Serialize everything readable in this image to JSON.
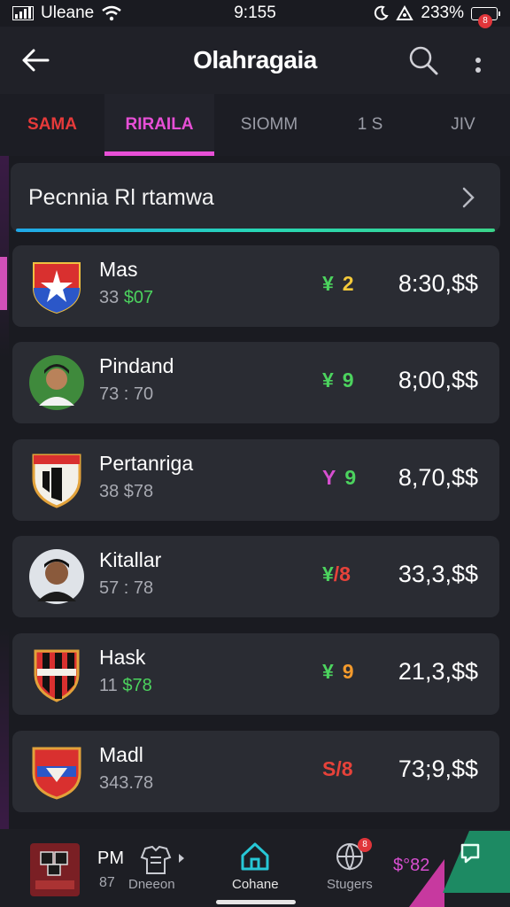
{
  "status_bar": {
    "carrier": "Uleane",
    "time": "9:155",
    "battery": "233%"
  },
  "app_bar": {
    "title": "Olahragaia",
    "badge": "8"
  },
  "tabs": [
    {
      "label": "SAMA"
    },
    {
      "label": "RIRAILA"
    },
    {
      "label": "SIOMM"
    },
    {
      "label": "1 S"
    },
    {
      "label": "JIV"
    }
  ],
  "featured": {
    "label": "Pecnnia Rl rtamwa"
  },
  "rows": [
    {
      "name": "Mas",
      "sub_prefix": "33 ",
      "sub_accent": "$07",
      "symbol": "¥",
      "score": "2",
      "symbol_color": "#4cd35e",
      "score_color": "#f3c93a",
      "price": "8:30,$$",
      "logo": "red-blue-crest-icon"
    },
    {
      "name": "Pindand",
      "sub_prefix": "73 : 70",
      "sub_accent": "",
      "symbol": "¥",
      "score": "9",
      "symbol_color": "#4cd35e",
      "score_color": "#4cd35e",
      "price": "8;00,$$",
      "logo": "player-photo-icon"
    },
    {
      "name": "Pertanriga",
      "sub_prefix": "38 $78",
      "sub_accent": "",
      "symbol": "Y",
      "score": "9",
      "symbol_color": "#d74fd0",
      "score_color": "#4cd35e",
      "price": "8,70,$$",
      "logo": "black-white-crest-icon"
    },
    {
      "name": "Kitallar",
      "sub_prefix": "57 : 78",
      "sub_accent": "",
      "symbol": "¥",
      "score": "/8",
      "symbol_color": "#4cd35e",
      "score_color": "#e6423a",
      "price": "33,3,$$",
      "logo": "player-photo-icon"
    },
    {
      "name": "Hask",
      "sub_prefix": "11 ",
      "sub_accent": "$78",
      "symbol": "¥",
      "score": "9",
      "symbol_color": "#4cd35e",
      "score_color": "#f39a2c",
      "price": "21,3,$$",
      "logo": "red-black-crest-icon"
    },
    {
      "name": "Madl",
      "sub_prefix": "343.78",
      "sub_accent": "",
      "symbol": "S",
      "score": "/8",
      "symbol_color": "#e6423a",
      "score_color": "#e6423a",
      "price": "73;9,$$",
      "logo": "red-blue-crest-icon"
    }
  ],
  "bottom_nav": {
    "partial_name": "PM",
    "partial_sub": "87",
    "items": [
      {
        "label": "Dneeon",
        "icon": "jersey-icon"
      },
      {
        "label": "Cohane",
        "icon": "home-icon"
      },
      {
        "label": "Stugers",
        "icon": "globe-icon",
        "badge": "8"
      }
    ],
    "promo": "$°82"
  },
  "colors": {
    "accent_pink": "#e74fd6",
    "accent_red": "#e63a3a",
    "accent_teal": "#27d6b6",
    "background": "#1a1b21",
    "card": "#2a2c33"
  }
}
